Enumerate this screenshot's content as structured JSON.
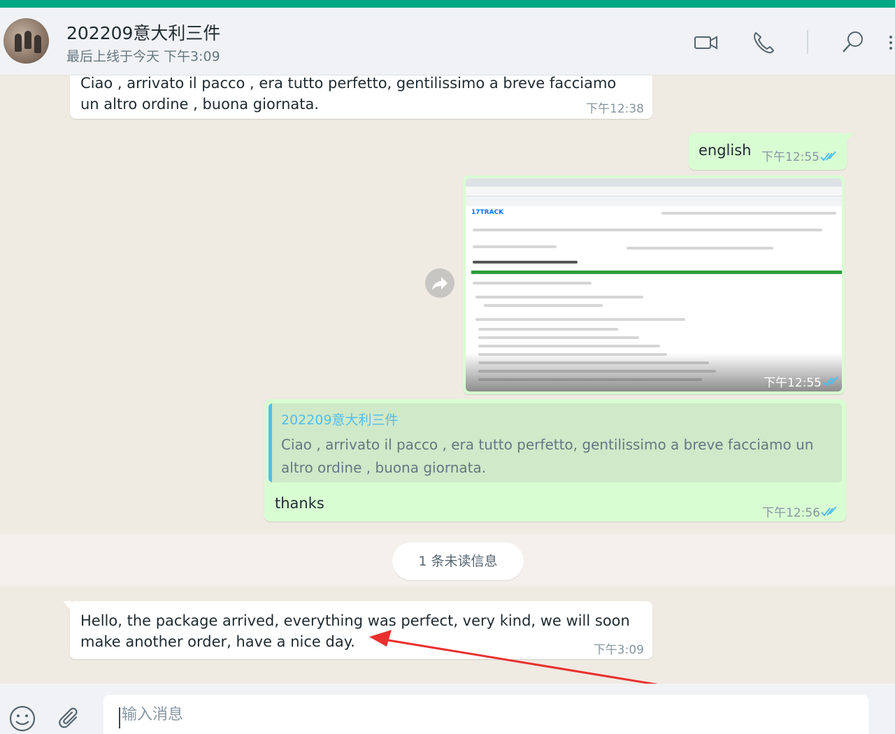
{
  "header": {
    "chat_name": "202209意大利三件",
    "status": "最后上线于今天 下午3:09"
  },
  "messages": {
    "m1": {
      "text": "Ciao , arrivato il pacco , era tutto perfetto, gentilissimo a breve facciamo un altro ordine , buona giornata.",
      "time": "下午12:38"
    },
    "m2": {
      "text": "english",
      "time": "下午12:55"
    },
    "m3": {
      "screenshot_logo": "17TRACK",
      "time": "下午12:55"
    },
    "m4": {
      "quote_name": "202209意大利三件",
      "quote_text": "Ciao , arrivato il pacco , era tutto perfetto, gentilissimo a breve facciamo un altro ordine , buona giornata.",
      "text": "thanks",
      "time": "下午12:56"
    },
    "m5": {
      "text": "Hello, the package arrived, everything was perfect, very kind, we will soon make another order, have a nice day.",
      "time": "下午3:09"
    }
  },
  "unread": {
    "label": "1 条未读信息"
  },
  "composer": {
    "placeholder": "输入消息"
  },
  "colors": {
    "accent": "#00a884",
    "outgoing": "#d9fdd3",
    "tick": "#53bdeb",
    "annotation_arrow": "#e8302f"
  },
  "icons": [
    "video-call-icon",
    "voice-call-icon",
    "search-icon",
    "menu-icon",
    "emoji-icon",
    "attach-icon",
    "forward-icon",
    "double-check-icon"
  ]
}
